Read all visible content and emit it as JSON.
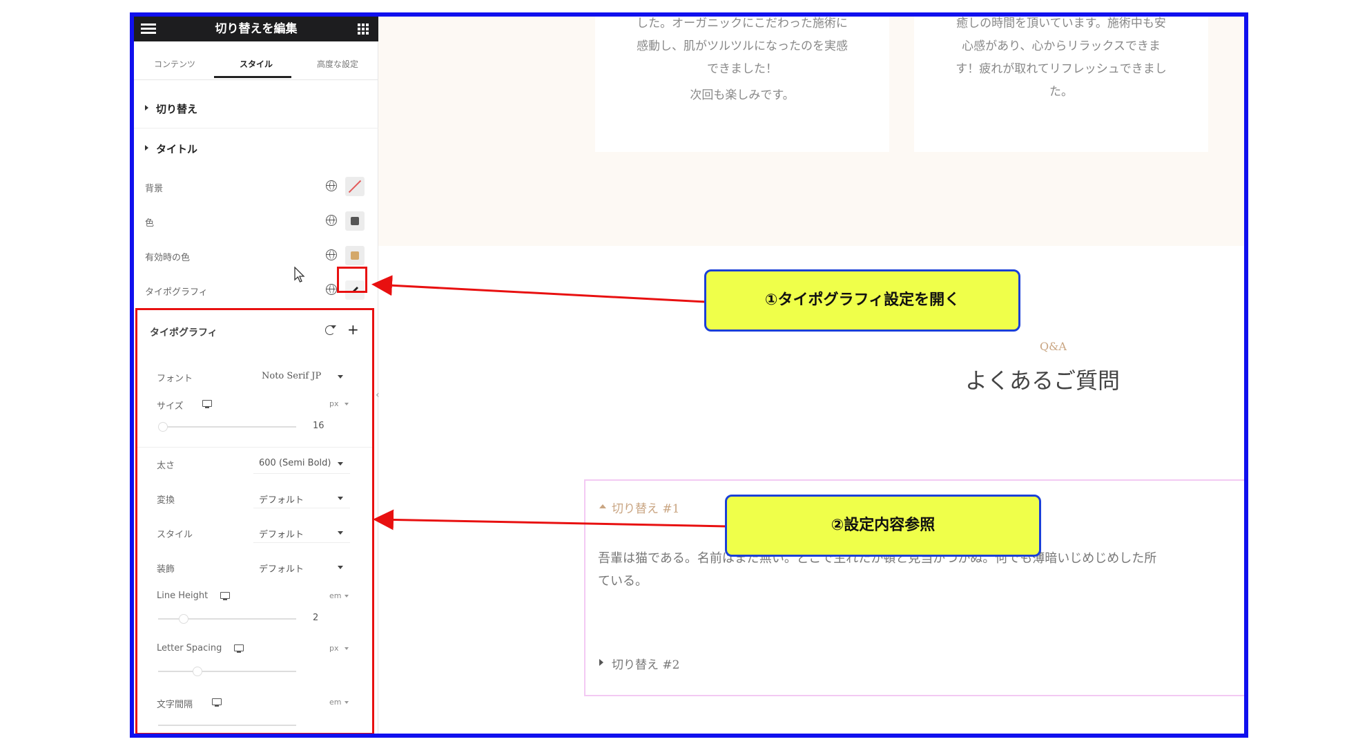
{
  "panel": {
    "title": "切り替えを編集",
    "tabs": [
      "コンテンツ",
      "スタイル",
      "高度な設定"
    ],
    "active_tab": "スタイル",
    "sections": [
      "切り替え",
      "タイトル"
    ],
    "rows": [
      {
        "label": "背景"
      },
      {
        "label": "色",
        "swatch_color": "#555555"
      },
      {
        "label": "有効時の色",
        "swatch_color": "#d4a86a"
      },
      {
        "label": "タイポグラフィ"
      }
    ]
  },
  "typography": {
    "title": "タイポグラフィ",
    "font": {
      "label": "フォント",
      "value": "Noto Serif JP"
    },
    "size": {
      "label": "サイズ",
      "unit": "px",
      "value": "16"
    },
    "weight": {
      "label": "太さ",
      "value": "600 (Semi Bold)"
    },
    "transform": {
      "label": "変換",
      "value": "デフォルト"
    },
    "style": {
      "label": "スタイル",
      "value": "デフォルト"
    },
    "decoration": {
      "label": "装飾",
      "value": "デフォルト"
    },
    "line_height": {
      "label": "Line Height",
      "unit": "em",
      "value": "2"
    },
    "letter_spacing": {
      "label": "Letter Spacing",
      "unit": "px"
    },
    "char_spacing": {
      "label": "文字間隔",
      "unit": "em"
    }
  },
  "content": {
    "testimonial_left": [
      "した。オーガニックにこだわった施術に",
      "感動し、肌がツルツルになったのを実感",
      "できました！",
      "次回も楽しみです。"
    ],
    "testimonial_right": [
      "癒しの時間を頂いています。施術中も安",
      "心感があり、心からリラックスできま",
      "す！疲れが取れてリフレッシュできまし",
      "た。"
    ],
    "eyebrow": "Q&A",
    "title": "よくあるご質問",
    "accordion": {
      "item1_title": "切り替え #1",
      "item1_body_line1": "吾輩は猫である。名前はまだ無い。どこで生れたか頓と見当がつかぬ。何でも薄暗いじめじめした所",
      "item1_body_line2": "ている。",
      "item2_title": "切り替え #2"
    }
  },
  "annotations": {
    "callout1": "①タイポグラフィ設定を開く",
    "callout2": "②設定内容参照"
  },
  "colors": {
    "frame": "#1010ee",
    "highlight": "#e81010",
    "callout_bg": "#efff4a",
    "accent": "#c9a582"
  }
}
